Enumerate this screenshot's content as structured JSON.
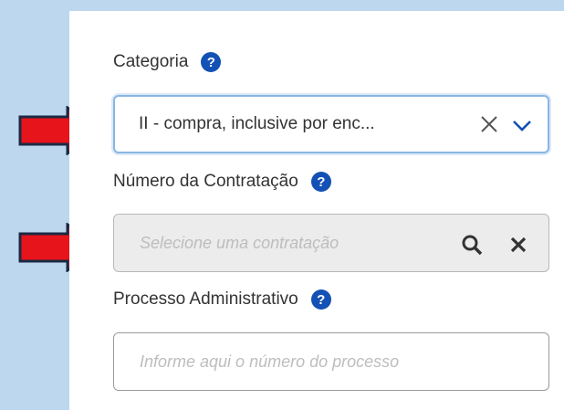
{
  "colors": {
    "background": "#bdd7ee",
    "accent": "#1351b4",
    "arrow": "#e8141b"
  },
  "categoria": {
    "label": "Categoria",
    "help_icon": "?",
    "selected_value": "II - compra, inclusive por enc...",
    "clear_icon": "close-icon",
    "dropdown_icon": "chevron-down-icon"
  },
  "numero_contratacao": {
    "label": "Número da Contratação",
    "help_icon": "?",
    "placeholder": "Selecione uma contratação",
    "search_icon": "search-icon",
    "clear_icon": "close-icon"
  },
  "processo_administrativo": {
    "label": "Processo Administrativo",
    "help_icon": "?",
    "placeholder": "Informe aqui o número do processo"
  }
}
